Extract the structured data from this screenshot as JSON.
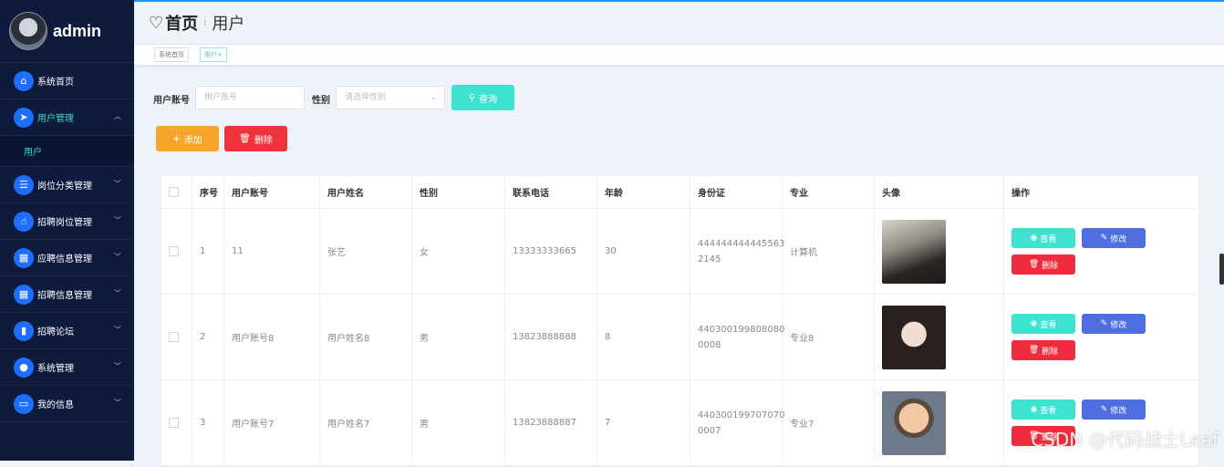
{
  "app": {
    "title": "admin"
  },
  "colors": {
    "sidebar_bg": "#0f1b3d",
    "accent": "#3fd4c9",
    "add": "#f7a42a",
    "delete": "#f0323d",
    "search": "#3ee3d0",
    "edit": "#4f6fe0"
  },
  "sidebar": {
    "items": [
      {
        "label": "系统首页",
        "icon": "home-icon"
      },
      {
        "label": "用户管理",
        "icon": "paper-plane-icon",
        "expanded": true,
        "children": [
          {
            "label": "用户"
          }
        ]
      },
      {
        "label": "岗位分类管理",
        "icon": "list-icon"
      },
      {
        "label": "招聘岗位管理",
        "icon": "thumbs-up-icon"
      },
      {
        "label": "应聘信息管理",
        "icon": "grid-icon"
      },
      {
        "label": "招聘信息管理",
        "icon": "grid-icon"
      },
      {
        "label": "招聘论坛",
        "icon": "bar-chart-icon"
      },
      {
        "label": "系统管理",
        "icon": "user-icon"
      },
      {
        "label": "我的信息",
        "icon": "card-icon"
      }
    ]
  },
  "header": {
    "home": "首页",
    "current": "用户"
  },
  "tags": [
    {
      "label": "系统首页"
    },
    {
      "label": "用户×"
    }
  ],
  "search": {
    "account_label": "用户账号",
    "account_placeholder": "用户账号",
    "gender_label": "性别",
    "gender_placeholder": "请选择性别",
    "search_label": "查询"
  },
  "actions": {
    "add_label": "添加",
    "delete_label": "删除"
  },
  "table": {
    "headers": [
      "",
      "序号",
      "用户账号",
      "用户姓名",
      "性别",
      "联系电话",
      "年龄",
      "身份证",
      "专业",
      "头像",
      "操作"
    ],
    "rows": [
      {
        "index": "1",
        "account": "11",
        "name": "张艺",
        "gender": "女",
        "phone": "13333333665",
        "age": "30",
        "id_card": "444444444445563 2145",
        "major": "计算机"
      },
      {
        "index": "2",
        "account": "用户账号8",
        "name": "用户姓名8",
        "gender": "男",
        "phone": "13823888888",
        "age": "8",
        "id_card": "440300199808080 0008",
        "major": "专业8"
      },
      {
        "index": "3",
        "account": "用户账号7",
        "name": "用户姓名7",
        "gender": "男",
        "phone": "13823888887",
        "age": "7",
        "id_card": "440300199707070 0007",
        "major": "专业7"
      }
    ],
    "row_actions": {
      "view": "查看",
      "edit": "修改",
      "delete": "删除"
    }
  },
  "watermark": "CSDN @代码战士Leaf"
}
